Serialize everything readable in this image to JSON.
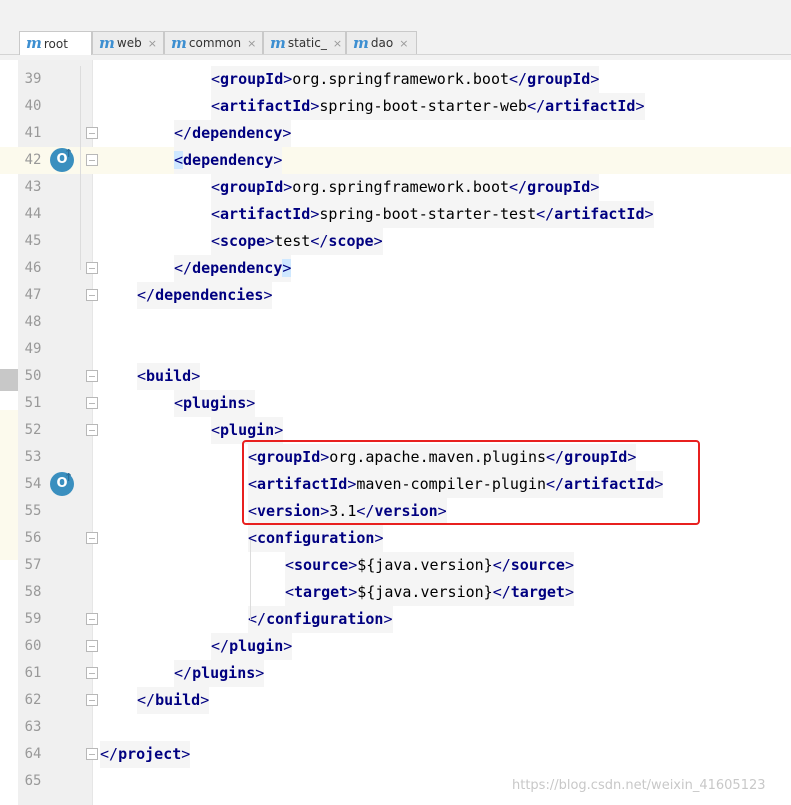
{
  "tabs": [
    {
      "label": "root",
      "close": "",
      "active": true
    },
    {
      "label": "web",
      "close": "×",
      "active": false
    },
    {
      "label": "common",
      "close": "×",
      "active": false
    },
    {
      "label": "static_",
      "close": "×",
      "active": false
    },
    {
      "label": "dao",
      "close": "×",
      "active": false
    }
  ],
  "tab_icon_letter": "m",
  "gutter_icon_label": "O",
  "gutter_icon_arrow": "↑",
  "lines": [
    {
      "n": "39",
      "indent": 3,
      "parts": [
        [
          "b",
          "<"
        ],
        [
          "t",
          "groupId"
        ],
        [
          "b",
          ">"
        ],
        [
          "x",
          "org.springframework.boot"
        ],
        [
          "b",
          "</"
        ],
        [
          "t",
          "groupId"
        ],
        [
          "b",
          ">"
        ]
      ]
    },
    {
      "n": "40",
      "indent": 3,
      "parts": [
        [
          "b",
          "<"
        ],
        [
          "t",
          "artifactId"
        ],
        [
          "b",
          ">"
        ],
        [
          "x",
          "spring-boot-starter-web"
        ],
        [
          "b",
          "</"
        ],
        [
          "t",
          "artifactId"
        ],
        [
          "b",
          ">"
        ]
      ]
    },
    {
      "n": "41",
      "indent": 2,
      "parts": [
        [
          "b",
          "</"
        ],
        [
          "t",
          "dependency"
        ],
        [
          "b",
          ">"
        ]
      ]
    },
    {
      "n": "42",
      "indent": 2,
      "parts": [
        [
          "m",
          "<"
        ],
        [
          "t",
          "dependency"
        ],
        [
          "b",
          ">"
        ]
      ]
    },
    {
      "n": "43",
      "indent": 3,
      "parts": [
        [
          "b",
          "<"
        ],
        [
          "t",
          "groupId"
        ],
        [
          "b",
          ">"
        ],
        [
          "x",
          "org.springframework.boot"
        ],
        [
          "b",
          "</"
        ],
        [
          "t",
          "groupId"
        ],
        [
          "b",
          ">"
        ]
      ]
    },
    {
      "n": "44",
      "indent": 3,
      "parts": [
        [
          "b",
          "<"
        ],
        [
          "t",
          "artifactId"
        ],
        [
          "b",
          ">"
        ],
        [
          "x",
          "spring-boot-starter-test"
        ],
        [
          "b",
          "</"
        ],
        [
          "t",
          "artifactId"
        ],
        [
          "b",
          ">"
        ]
      ]
    },
    {
      "n": "45",
      "indent": 3,
      "parts": [
        [
          "b",
          "<"
        ],
        [
          "t",
          "scope"
        ],
        [
          "b",
          ">"
        ],
        [
          "x",
          "test"
        ],
        [
          "b",
          "</"
        ],
        [
          "t",
          "scope"
        ],
        [
          "b",
          ">"
        ]
      ]
    },
    {
      "n": "46",
      "indent": 2,
      "parts": [
        [
          "b",
          "</"
        ],
        [
          "t",
          "dependency"
        ],
        [
          "m",
          ">"
        ]
      ]
    },
    {
      "n": "47",
      "indent": 1,
      "parts": [
        [
          "b",
          "</"
        ],
        [
          "t",
          "dependencies"
        ],
        [
          "b",
          ">"
        ]
      ]
    },
    {
      "n": "48",
      "indent": 0,
      "parts": []
    },
    {
      "n": "49",
      "indent": 0,
      "parts": []
    },
    {
      "n": "50",
      "indent": 1,
      "parts": [
        [
          "b",
          "<"
        ],
        [
          "t",
          "build"
        ],
        [
          "b",
          ">"
        ]
      ]
    },
    {
      "n": "51",
      "indent": 2,
      "parts": [
        [
          "b",
          "<"
        ],
        [
          "t",
          "plugins"
        ],
        [
          "b",
          ">"
        ]
      ]
    },
    {
      "n": "52",
      "indent": 3,
      "parts": [
        [
          "b",
          "<"
        ],
        [
          "t",
          "plugin"
        ],
        [
          "b",
          ">"
        ]
      ]
    },
    {
      "n": "53",
      "indent": 4,
      "parts": [
        [
          "b",
          "<"
        ],
        [
          "t",
          "groupId"
        ],
        [
          "b",
          ">"
        ],
        [
          "x",
          "org.apache.maven.plugins"
        ],
        [
          "b",
          "</"
        ],
        [
          "t",
          "groupId"
        ],
        [
          "b",
          ">"
        ]
      ]
    },
    {
      "n": "54",
      "indent": 4,
      "parts": [
        [
          "b",
          "<"
        ],
        [
          "t",
          "artifactId"
        ],
        [
          "b",
          ">"
        ],
        [
          "x",
          "maven-compiler-plugin"
        ],
        [
          "b",
          "</"
        ],
        [
          "t",
          "artifactId"
        ],
        [
          "b",
          ">"
        ]
      ]
    },
    {
      "n": "55",
      "indent": 4,
      "parts": [
        [
          "b",
          "<"
        ],
        [
          "t",
          "version"
        ],
        [
          "b",
          ">"
        ],
        [
          "x",
          "3.1"
        ],
        [
          "b",
          "</"
        ],
        [
          "t",
          "version"
        ],
        [
          "b",
          ">"
        ]
      ]
    },
    {
      "n": "56",
      "indent": 4,
      "parts": [
        [
          "b",
          "<"
        ],
        [
          "t",
          "configuration"
        ],
        [
          "b",
          ">"
        ]
      ]
    },
    {
      "n": "57",
      "indent": 5,
      "parts": [
        [
          "b",
          "<"
        ],
        [
          "t",
          "source"
        ],
        [
          "b",
          ">"
        ],
        [
          "x",
          "${java.version}"
        ],
        [
          "b",
          "</"
        ],
        [
          "t",
          "source"
        ],
        [
          "b",
          ">"
        ]
      ]
    },
    {
      "n": "58",
      "indent": 5,
      "parts": [
        [
          "b",
          "<"
        ],
        [
          "t",
          "target"
        ],
        [
          "b",
          ">"
        ],
        [
          "x",
          "${java.version}"
        ],
        [
          "b",
          "</"
        ],
        [
          "t",
          "target"
        ],
        [
          "b",
          ">"
        ]
      ]
    },
    {
      "n": "59",
      "indent": 4,
      "parts": [
        [
          "b",
          "</"
        ],
        [
          "t",
          "configuration"
        ],
        [
          "b",
          ">"
        ]
      ]
    },
    {
      "n": "60",
      "indent": 3,
      "parts": [
        [
          "b",
          "</"
        ],
        [
          "t",
          "plugin"
        ],
        [
          "b",
          ">"
        ]
      ]
    },
    {
      "n": "61",
      "indent": 2,
      "parts": [
        [
          "b",
          "</"
        ],
        [
          "t",
          "plugins"
        ],
        [
          "b",
          ">"
        ]
      ]
    },
    {
      "n": "62",
      "indent": 1,
      "parts": [
        [
          "b",
          "</"
        ],
        [
          "t",
          "build"
        ],
        [
          "b",
          ">"
        ]
      ]
    },
    {
      "n": "63",
      "indent": 0,
      "parts": []
    },
    {
      "n": "64",
      "indent": 0,
      "parts": [
        [
          "b",
          "</"
        ],
        [
          "t",
          "project"
        ],
        [
          "b",
          ">"
        ]
      ]
    },
    {
      "n": "65",
      "indent": 0,
      "parts": []
    }
  ],
  "watermark": "https://blog.csdn.net/weixin_41605123",
  "colors": {
    "tag": "#000080",
    "highlight_box": "#e8201f",
    "current_line": "#fcfaed"
  }
}
